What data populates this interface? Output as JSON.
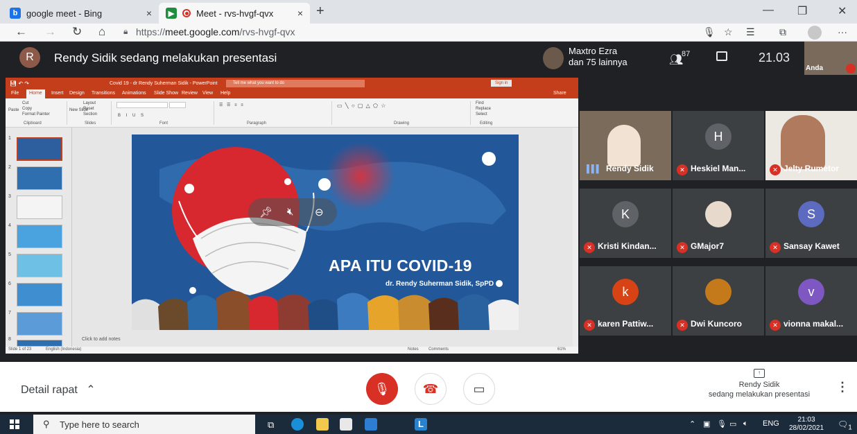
{
  "browser": {
    "tabs": [
      {
        "title": "google meet - Bing",
        "close": "×"
      },
      {
        "title": "Meet - rvs-hvgf-qvx",
        "close": "×"
      }
    ],
    "new_tab": "+",
    "url_prefix": "https://",
    "url_domain": "meet.google.com",
    "url_path": "/rvs-hvgf-qvx"
  },
  "meet": {
    "presenter_initial": "R",
    "presenter_banner": "Rendy Sidik sedang melakukan presentasi",
    "others_line1": "Maxtro Ezra",
    "others_line2": "dan 75 lainnya",
    "participant_count": "87",
    "time": "21.03",
    "self_label": "Anda"
  },
  "presentation": {
    "window_title": "Covid 19 - dr Rendy Suherman Sidik - PowerPoint",
    "tell_me": "Tell me what you want to do",
    "sign_in": "Sign in",
    "share": "Share",
    "ribbon_tabs": [
      "File",
      "Home",
      "Insert",
      "Design",
      "Transitions",
      "Animations",
      "Slide Show",
      "Review",
      "View",
      "Help"
    ],
    "ribbon_groups": [
      "Clipboard",
      "Slides",
      "Font",
      "Paragraph",
      "Drawing",
      "Editing"
    ],
    "ribbon_items": {
      "cut": "Cut",
      "copy": "Copy",
      "format_painter": "Format Painter",
      "paste": "Paste",
      "layout": "Layout",
      "reset": "Reset",
      "section": "Section",
      "new_slide": "New Slide",
      "find": "Find",
      "replace": "Replace",
      "select": "Select"
    },
    "slide_numbers": [
      "1",
      "2",
      "3",
      "4",
      "5",
      "6",
      "7",
      "8"
    ],
    "slide_title": "APA ITU COVID-19",
    "slide_author": "dr. Rendy Suherman Sidik, SpPD",
    "notes_placeholder": "Click to add notes",
    "status_left": "Slide 1 of 23",
    "status_lang": "English (Indonesia)",
    "status_notes": "Notes",
    "status_comments": "Comments",
    "zoom": "61%"
  },
  "participants": [
    {
      "name": "Rendy Sidik",
      "type": "video",
      "speaking": true
    },
    {
      "name": "Heskiel Man...",
      "initial": "H",
      "color": "#5f6368",
      "muted": true
    },
    {
      "name": "Jelty Rumetor",
      "type": "video",
      "muted": true
    },
    {
      "name": "Kristi Kindan...",
      "initial": "K",
      "color": "#5f6368",
      "muted": true
    },
    {
      "name": "GMajor7",
      "type": "photo",
      "muted": true
    },
    {
      "name": "Sansay Kawet",
      "initial": "S",
      "color": "#5c6bc0",
      "muted": true
    },
    {
      "name": "karen Pattiw...",
      "initial": "k",
      "color": "#d84315",
      "muted": true
    },
    {
      "name": "Dwi Kuncoro",
      "type": "photo",
      "muted": true
    },
    {
      "name": "vionna makal...",
      "initial": "v",
      "color": "#7e57c2",
      "muted": true
    }
  ],
  "controls": {
    "details": "Detail rapat",
    "presenting_line1": "Rendy Sidik",
    "presenting_line2": "sedang melakukan presentasi"
  },
  "taskbar": {
    "search_placeholder": "Type here to search",
    "lang": "ENG",
    "time": "21:03",
    "date": "28/02/2021",
    "notif_count": "1"
  },
  "colors": {
    "meet_bg": "#202124",
    "ppt_accent": "#c43e1c",
    "mute_red": "#d93025",
    "slide_blue": "#22589a"
  }
}
